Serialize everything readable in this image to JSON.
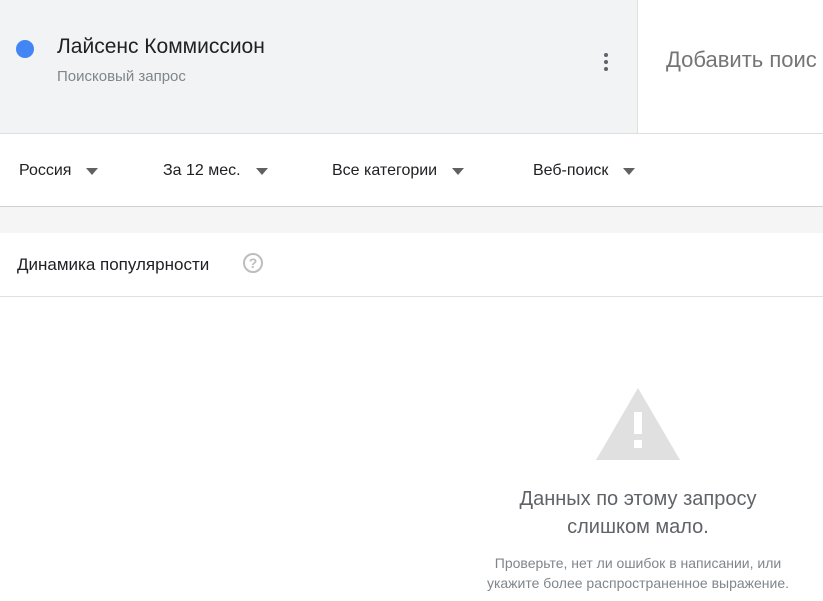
{
  "header": {
    "term": {
      "title": "Лайсенс Коммиссион",
      "subtitle": "Поисковый запрос",
      "color": "#4285f4"
    },
    "add_term_placeholder": "Добавить поис"
  },
  "filters": [
    {
      "label": "Россия"
    },
    {
      "label": "За 12 мес."
    },
    {
      "label": "Все категории"
    },
    {
      "label": "Веб-поиск"
    }
  ],
  "widget": {
    "title": "Динамика популярности",
    "empty": {
      "title_line1": "Данных по этому запросу",
      "title_line2": "слишком мало.",
      "hint_line1": "Проверьте, нет ли ошибок в написании, или",
      "hint_line2": "укажите более распространенное выражение."
    }
  },
  "colors": {
    "header_bg": "#f1f3f4",
    "accent": "#4285f4",
    "warning_icon": "#e0e0e0"
  }
}
